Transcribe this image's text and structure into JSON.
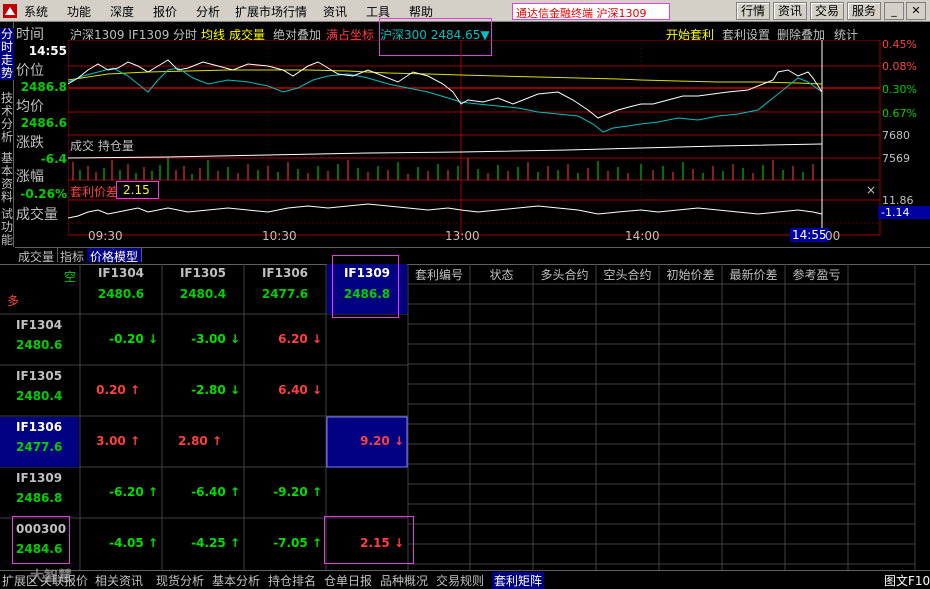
{
  "menu": [
    "系统",
    "功能",
    "深度",
    "报价",
    "分析",
    "扩展市场行情",
    "资讯",
    "工具",
    "帮助"
  ],
  "terminal_title": "通达信金融终端 沪深1309",
  "top_buttons": [
    "行情",
    "资讯",
    "交易",
    "服务"
  ],
  "window_buttons": [
    "minimize",
    "restore",
    "close"
  ],
  "vtabs": [
    "分时走势",
    "技术分析",
    "基本资料",
    "试功能"
  ],
  "left_panel": {
    "time_label": "时间",
    "time_value": "14:55",
    "price_label": "价位",
    "price_value": "2486.8",
    "avg_label": "均价",
    "avg_value": "2486.6",
    "chg_label": "涨跌",
    "chg_value": "-6.4",
    "pct_label": "涨幅",
    "pct_value": "-0.26%",
    "vol_label": "成交量"
  },
  "chart_header": {
    "title": "沪深1309 IF1309",
    "mode": "分时",
    "avg_line": "均线",
    "volume": "成交量",
    "abs_overlay": "绝对叠加",
    "full_coord": "满占坐标",
    "overlay_index": "沪深300 2484.65▼",
    "start_arb": "开始套利",
    "arb_settings": "套利设置",
    "remove_overlay": "删除叠加",
    "stats": "统计"
  },
  "right_axis": [
    "0.45%",
    "0.08%",
    "0.30%",
    "0.67%",
    "7680",
    "7569",
    "11.86",
    "-1.14"
  ],
  "volume_panel_label": "成交 持仓量",
  "spread_label": "套利价差",
  "spread_value": "2.15",
  "close_x": "×",
  "time_axis": [
    "09:30",
    "10:30",
    "13:00",
    "14:00",
    "14:55",
    "00"
  ],
  "bottom_tabs": [
    "成交量",
    "指标",
    "价格模型"
  ],
  "matrix": {
    "corner_empty": "空",
    "corner_long": "多",
    "columns": [
      {
        "code": "IF1304",
        "price": "2480.6"
      },
      {
        "code": "IF1305",
        "price": "2480.4"
      },
      {
        "code": "IF1306",
        "price": "2477.6"
      },
      {
        "code": "IF1309",
        "price": "2486.8"
      }
    ],
    "rows": [
      {
        "code": "IF1304",
        "price": "2480.6",
        "cells": [
          "",
          "-0.20 ↓",
          "-3.00 ↓",
          "6.20 ↓"
        ],
        "dirs": [
          "",
          "dn",
          "dn",
          "up"
        ]
      },
      {
        "code": "IF1305",
        "price": "2480.4",
        "cells": [
          "0.20 ↑",
          "",
          "-2.80 ↓",
          "6.40 ↓"
        ],
        "dirs": [
          "up",
          "",
          "dn",
          "up"
        ]
      },
      {
        "code": "IF1306",
        "price": "2477.6",
        "cells": [
          "3.00 ↑",
          "2.80 ↑",
          "",
          "9.20 ↓"
        ],
        "dirs": [
          "up",
          "up",
          "",
          "up"
        ]
      },
      {
        "code": "IF1309",
        "price": "2486.8",
        "cells": [
          "-6.20 ↑",
          "-6.40 ↑",
          "-9.20 ↑",
          ""
        ],
        "dirs": [
          "dn",
          "dn",
          "dn",
          ""
        ]
      },
      {
        "code": "000300",
        "price": "2484.6",
        "cells": [
          "-4.05 ↑",
          "-4.25 ↑",
          "-7.05 ↑",
          "2.15 ↓"
        ],
        "dirs": [
          "dn",
          "dn",
          "dn",
          "up"
        ]
      }
    ]
  },
  "arb_table_headers": [
    "套利编号",
    "状态",
    "多头合约",
    "空头合约",
    "初始价差",
    "最新价差",
    "参考盈亏"
  ],
  "status_tabs": [
    "扩展区",
    "关联报价",
    "相关资讯",
    "现货分析",
    "基本分析",
    "持仓排名",
    "仓单日报",
    "品种概况",
    "交易规则",
    "套利矩阵"
  ],
  "status_right": "图文F10",
  "watermark": "大智慧"
}
